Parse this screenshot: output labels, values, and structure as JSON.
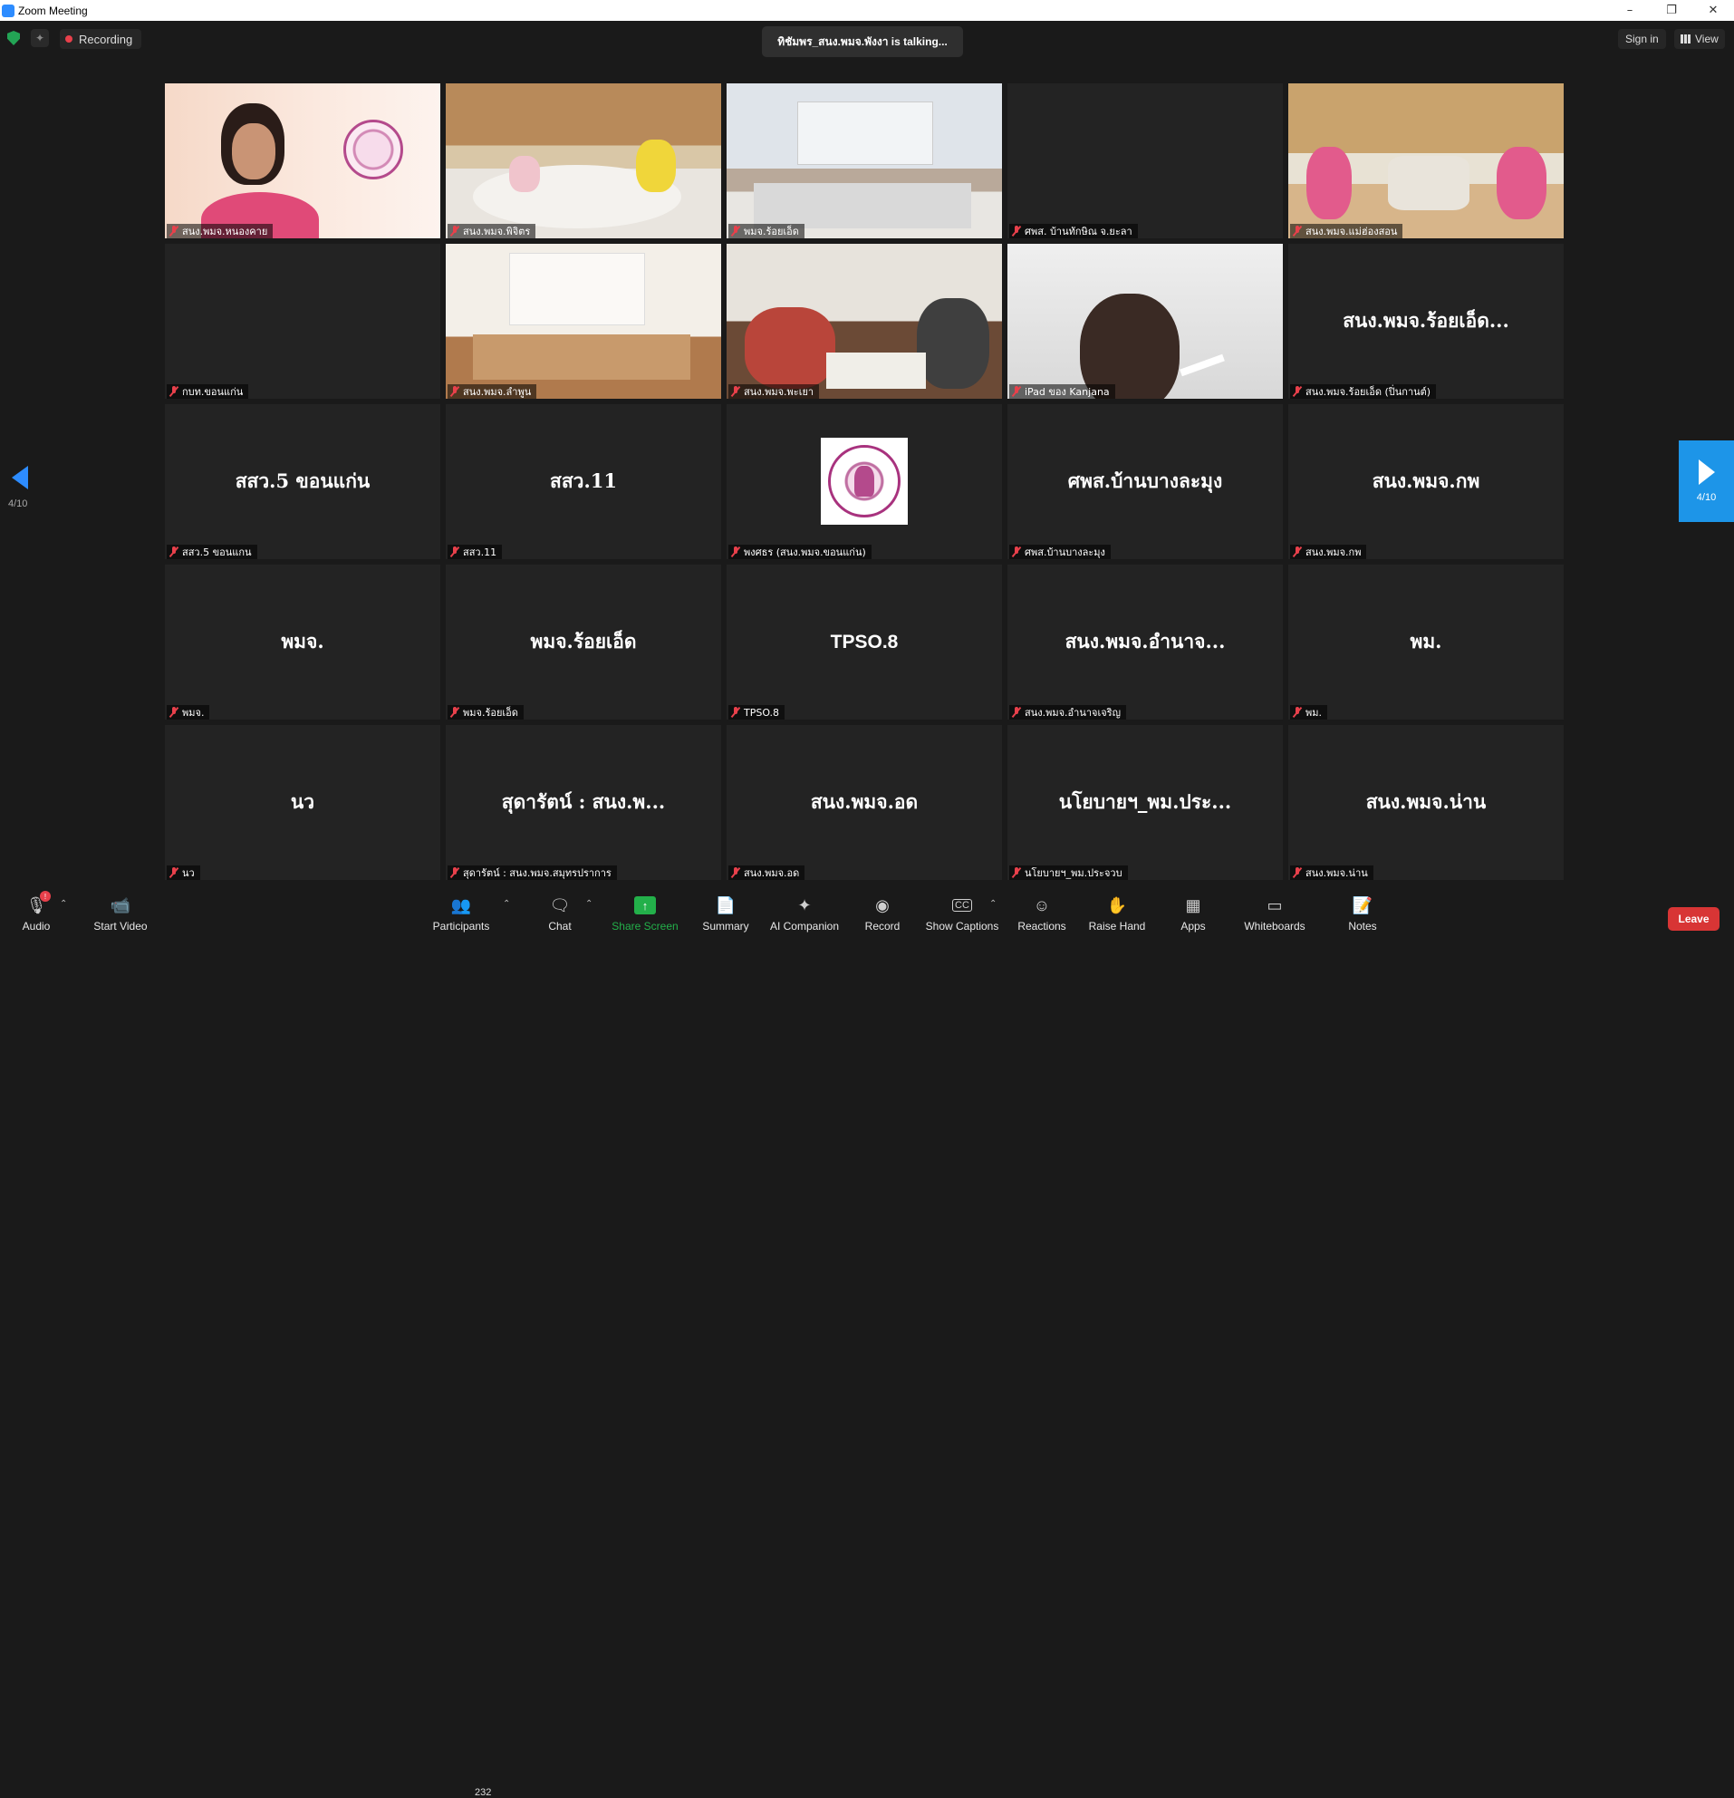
{
  "window": {
    "title": "Zoom Meeting"
  },
  "topbar": {
    "recording_label": "Recording",
    "talking": "ทิชัมพร_สนง.พมจ.พังงา is  talking...",
    "sign_in": "Sign in",
    "view": "View"
  },
  "pager": {
    "left": "4/10",
    "right": "4/10"
  },
  "tiles": [
    {
      "center": "",
      "label": "สนง.พมจ.หนองคาย"
    },
    {
      "center": "",
      "label": "สนง.พมจ.พิจิตร"
    },
    {
      "center": "",
      "label": "พมจ.ร้อยเอ็ด"
    },
    {
      "center": "",
      "label": "ศพส. บ้านทักษิณ จ.ยะลา"
    },
    {
      "center": "",
      "label": "สนง.พมจ.แม่ฮ่องสอน"
    },
    {
      "center": "",
      "label": "กบท.ขอนแก่น"
    },
    {
      "center": "",
      "label": "สนง.พมจ.ลำพูน"
    },
    {
      "center": "",
      "label": "สนง.พมจ.พะเยา"
    },
    {
      "center": "",
      "label": "iPad ของ Kanjana"
    },
    {
      "center": "สนง.พมจ.ร้อยเอ็ด...",
      "label": "สนง.พมจ.ร้อยเอ็ด (ปิ่นกานต์)"
    },
    {
      "center": "สสว.5 ขอนแก่น",
      "label": "สสว.5 ขอนแกน"
    },
    {
      "center": "สสว.11",
      "label": "สสว.11"
    },
    {
      "center": "",
      "label": "พงศธร (สนง.พมจ.ขอนแก่น)"
    },
    {
      "center": "ศพส.บ้านบางละมุง",
      "label": "ศพส.บ้านบางละมุง"
    },
    {
      "center": "สนง.พมจ.กพ",
      "label": "สนง.พมจ.กพ"
    },
    {
      "center": "พมจ.",
      "label": "พมจ."
    },
    {
      "center": "พมจ.ร้อยเอ็ด",
      "label": "พมจ.ร้อยเอ็ด"
    },
    {
      "center": "TPSO.8",
      "label": "TPSO.8"
    },
    {
      "center": "สนง.พมจ.อำนาจ...",
      "label": "สนง.พมจ.อำนาจเจริญ"
    },
    {
      "center": "พม.",
      "label": "พม."
    },
    {
      "center": "นว",
      "label": "นว"
    },
    {
      "center": "สุดารัตน์ : สนง.พ...",
      "label": "สุดารัตน์ : สนง.พมจ.สมุทรปราการ"
    },
    {
      "center": "สนง.พมจ.อด",
      "label": "สนง.พมจ.อด"
    },
    {
      "center": "นโยบายฯ_พม.ประ...",
      "label": "นโยบายฯ_พม.ประจวบ"
    },
    {
      "center": "สนง.พมจ.น่าน",
      "label": "สนง.พมจ.น่าน"
    }
  ],
  "toolbar": {
    "audio": "Audio",
    "start_video": "Start Video",
    "participants": "Participants",
    "participant_count": "232",
    "chat": "Chat",
    "share_screen": "Share Screen",
    "summary": "Summary",
    "ai_companion": "AI Companion",
    "record": "Record",
    "show_captions": "Show Captions",
    "reactions": "Reactions",
    "raise_hand": "Raise Hand",
    "apps": "Apps",
    "whiteboards": "Whiteboards",
    "notes": "Notes",
    "leave": "Leave"
  },
  "colors": {
    "accent": "#2d8cff",
    "leave": "#d83535",
    "share": "#23b04a",
    "muted": "#e8404b"
  }
}
